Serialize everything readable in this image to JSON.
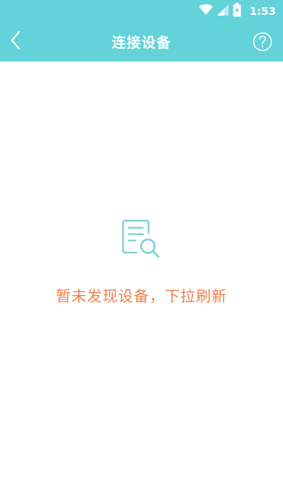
{
  "status_bar": {
    "time": "1:53",
    "icons": [
      "wifi-icon",
      "signal-icon",
      "battery-charging-icon"
    ]
  },
  "header": {
    "title": "连接设备",
    "back_icon": "chevron-left-icon",
    "help_icon": "question-circle-icon"
  },
  "empty_state": {
    "icon": "document-search-icon",
    "message": "暂未发现设备，下拉刷新"
  },
  "colors": {
    "header_bg": "#63d2d9",
    "accent_text": "#f0804a",
    "icon_stroke": "#7fd2da"
  }
}
